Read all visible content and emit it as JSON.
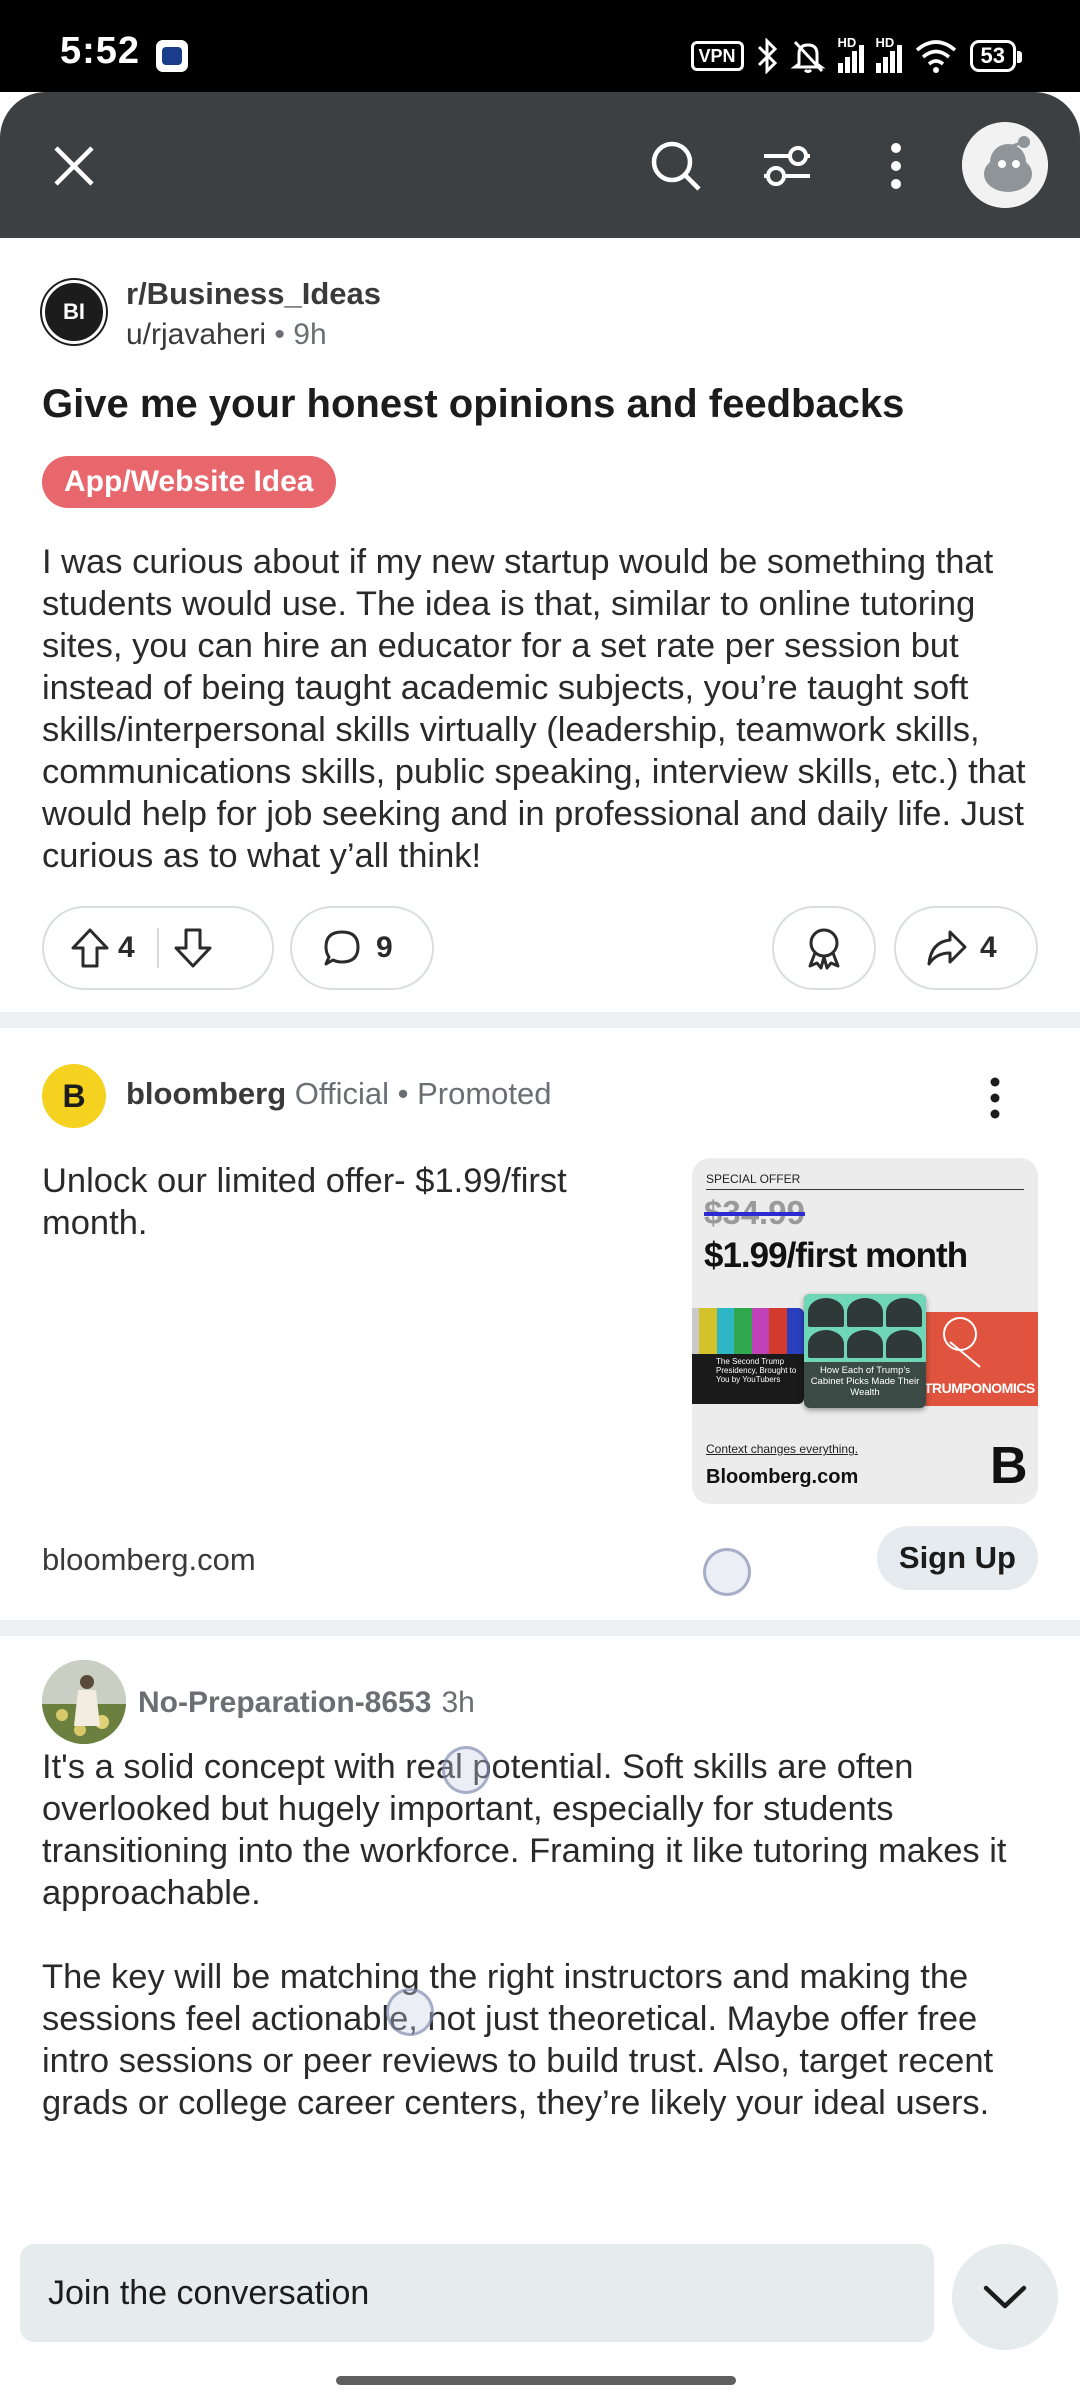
{
  "status_bar": {
    "time": "5:52",
    "vpn": "VPN",
    "network1": "HD",
    "network2": "HD",
    "battery": "53"
  },
  "app_bar": {
    "icons": [
      "close-icon",
      "search-icon",
      "sort-icon",
      "more-vertical-icon",
      "avatar"
    ],
    "background": "#3d4043"
  },
  "post": {
    "subreddit": "r/Business_Ideas",
    "subreddit_logo_text": "BI",
    "author": "u/rjavaheri",
    "separator": "•",
    "age": "9h",
    "title": "Give me your honest opinions and feedbacks",
    "flair": "App/Website Idea",
    "flair_color": "#e8676d",
    "body": "I was curious about if my new startup would be something that students would use. The idea is that, similar to online tutoring sites, you can hire an educator for a set rate per session but instead of being taught academic subjects, you’re taught soft skills/interpersonal skills virtually (leadership, teamwork skills, communications skills, public speaking, interview skills, etc.) that would help for job seeking and in professional and daily life. Just curious as to what y’all think!",
    "votes": "4",
    "comments": "9",
    "shares": "4"
  },
  "ad": {
    "logo_letter": "B",
    "advertiser": "bloomberg",
    "official": "Official",
    "separator": "•",
    "promoted": "Promoted",
    "text": "Unlock our limited offer- $1.99/first month.",
    "domain": "bloomberg.com",
    "cta": "Sign Up",
    "image": {
      "tag": "SPECIAL OFFER",
      "old_price": "$34.99",
      "price": "$1.99/first month",
      "card1": "The Second Trump Presidency, Brought to You by YouTubers",
      "card2": "How Each of Trump’s Cabinet Picks Made Their Wealth",
      "card3": "TRUMPONOMICS",
      "tagline": "Context changes everything.",
      "site": "Bloomberg.com",
      "mark": "B"
    }
  },
  "comment": {
    "user": "No-Preparation-8653",
    "age": "3h",
    "paragraph1": "It's a solid concept with real potential. Soft skills are often overlooked but hugely important, especially for students transitioning into the workforce. Framing it like tutoring makes it approachable.",
    "paragraph2": "The key will be matching the right instructors and making the sessions feel actionable, not just theoretical. Maybe offer free intro sessions or peer reviews to build trust. Also, target recent grads or college career centers, they’re likely your ideal users."
  },
  "bottom": {
    "placeholder": "Join the conversation"
  }
}
